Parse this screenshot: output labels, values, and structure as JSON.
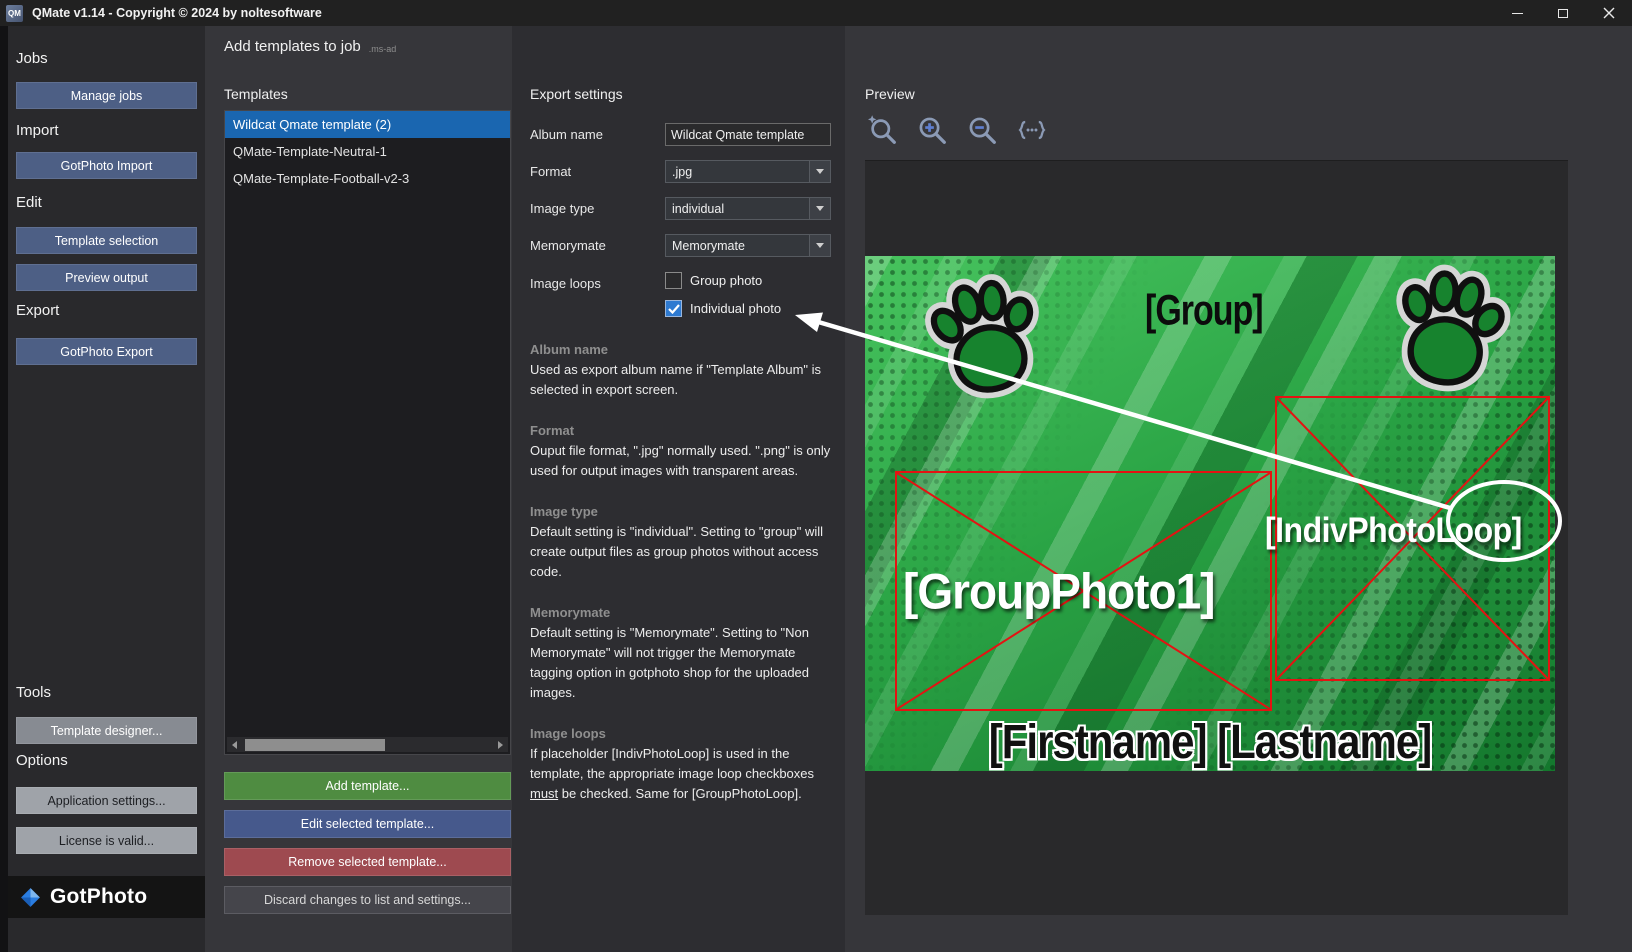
{
  "window": {
    "icon_text": "QM",
    "title": "QMate v1.14 - Copyright © 2024 by noltesoftware"
  },
  "sidebar": {
    "jobs_heading": "Jobs",
    "manage_jobs": "Manage jobs",
    "import_heading": "Import",
    "gotphoto_import": "GotPhoto Import",
    "edit_heading": "Edit",
    "template_selection": "Template selection",
    "preview_output": "Preview output",
    "export_heading": "Export",
    "gotphoto_export": "GotPhoto Export",
    "tools_heading": "Tools",
    "template_designer": "Template designer...",
    "options_heading": "Options",
    "application_settings": "Application settings...",
    "license": "License is valid...",
    "logo_text": "GotPhoto"
  },
  "header": {
    "title": "Add templates to job",
    "suffix": ".ms-ad"
  },
  "templates": {
    "heading": "Templates",
    "items": [
      {
        "label": "Wildcat Qmate template (2)",
        "selected": true
      },
      {
        "label": "QMate-Template-Neutral-1",
        "selected": false
      },
      {
        "label": "QMate-Template-Football-v2-3",
        "selected": false
      }
    ],
    "add_button": "Add template...",
    "edit_button": "Edit selected template...",
    "remove_button": "Remove selected template...",
    "discard_button": "Discard changes to list and settings..."
  },
  "export_settings": {
    "heading": "Export settings",
    "album_name_label": "Album name",
    "album_name_value": "Wildcat Qmate template",
    "format_label": "Format",
    "format_value": ".jpg",
    "image_type_label": "Image type",
    "image_type_value": "individual",
    "memorymate_label": "Memorymate",
    "memorymate_value": "Memorymate",
    "image_loops_label": "Image loops",
    "group_photo_label": "Group photo",
    "group_photo_checked": false,
    "individual_photo_label": "Individual photo",
    "individual_photo_checked": true,
    "help": [
      {
        "title": "Album name",
        "text": "Used as export album name if \"Template Album\" is selected in export screen."
      },
      {
        "title": "Format",
        "text": "Ouput file format, \".jpg\" normally used. \".png\" is only used for output images with transparent areas."
      },
      {
        "title": "Image type",
        "text": "Default setting is \"individual\". Setting to \"group\" will create output files as group photos without access code."
      },
      {
        "title": "Memorymate",
        "text": "Default setting is \"Memorymate\". Setting to \"Non Memorymate\" will not trigger the Memorymate tagging option in gotphoto shop for the uploaded images."
      },
      {
        "title": "Image loops",
        "text_before": "If placeholder [IndivPhotoLoop] is used in the template, the appropriate image loop checkboxes ",
        "text_underlined": "must",
        "text_after": " be checked. Same for [GroupPhotoLoop]."
      }
    ]
  },
  "preview": {
    "heading": "Preview",
    "toolbar_icons": [
      "zoom-reset",
      "zoom-in",
      "zoom-out",
      "placeholder-braces"
    ],
    "placeholders": {
      "group": "[Group]",
      "group_photo": "[GroupPhoto1]",
      "indiv_photo_loop": "[IndivPhotoLoop]",
      "name_line": "[Firstname] [Lastname]"
    }
  },
  "colors": {
    "selection_blue": "#1a66b0",
    "button_steel": "#4d5f85",
    "button_green": "#4f8c41",
    "button_blue": "#46598c",
    "button_red": "#9e4a50",
    "checkbox_checked": "#2e7ad1",
    "placeholder_red": "#e51212",
    "template_green": "#2aa445",
    "annotation_white": "#ffffff"
  }
}
